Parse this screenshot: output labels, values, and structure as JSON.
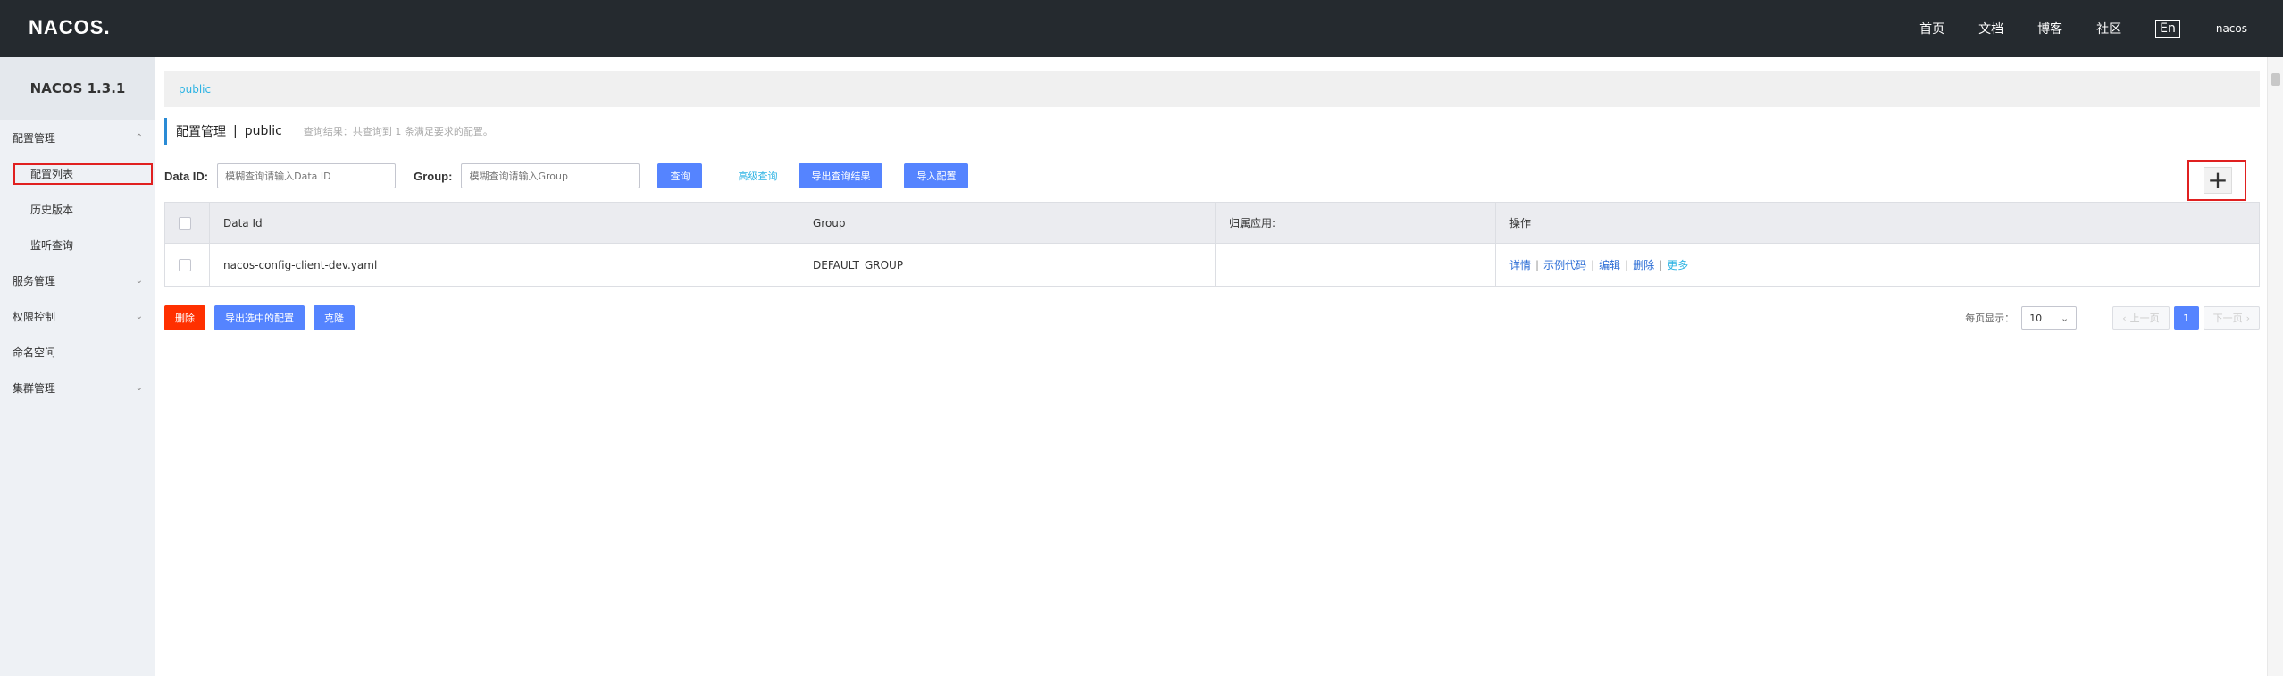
{
  "topbar": {
    "logo": "NACOS.",
    "nav": [
      "首页",
      "文档",
      "博客",
      "社区"
    ],
    "lang": "En",
    "user": "nacos"
  },
  "sidebar": {
    "version": "NACOS 1.3.1",
    "menu": [
      {
        "label": "配置管理",
        "chevron": "chevron-up-icon"
      },
      {
        "label": "配置列表",
        "sub": true,
        "active": true
      },
      {
        "label": "历史版本",
        "sub": true
      },
      {
        "label": "监听查询",
        "sub": true
      },
      {
        "label": "服务管理",
        "chevron": "chevron-down-icon"
      },
      {
        "label": "权限控制",
        "chevron": "chevron-down-icon"
      },
      {
        "label": "命名空间"
      },
      {
        "label": "集群管理",
        "chevron": "chevron-down-icon"
      }
    ]
  },
  "namespace_bar": {
    "current": "public"
  },
  "page_title": {
    "title": "配置管理",
    "separator": "|",
    "namespace": "public",
    "result_hint": "查询结果：共查询到 1 条满足要求的配置。"
  },
  "search": {
    "data_id_label": "Data ID:",
    "data_id_placeholder": "模糊查询请输入Data ID",
    "group_label": "Group:",
    "group_placeholder": "模糊查询请输入Group",
    "query_button": "查询",
    "advanced_link": "高级查询",
    "export_results_button": "导出查询结果",
    "import_button": "导入配置"
  },
  "add_button": {
    "icon": "plus-icon",
    "glyph": "+"
  },
  "table": {
    "headers": [
      "Data Id",
      "Group",
      "归属应用:",
      "操作"
    ],
    "rows": [
      {
        "data_id": "nacos-config-client-dev.yaml",
        "group": "DEFAULT_GROUP",
        "app": "",
        "ops": [
          "详情",
          "示例代码",
          "编辑",
          "删除",
          "更多"
        ]
      }
    ]
  },
  "bottom_actions": {
    "delete_button": "删除",
    "export_selected_button": "导出选中的配置",
    "clone_button": "克隆"
  },
  "pager": {
    "per_page_label": "每页显示：",
    "per_page_value": "10",
    "prev": "上一页",
    "current": "1",
    "next": "下一页"
  },
  "colors": {
    "topbar": "#252a2f",
    "primary": "#5584ff",
    "danger": "#ff3000",
    "highlight_border": "#e02020",
    "link": "#2cb3e3"
  }
}
